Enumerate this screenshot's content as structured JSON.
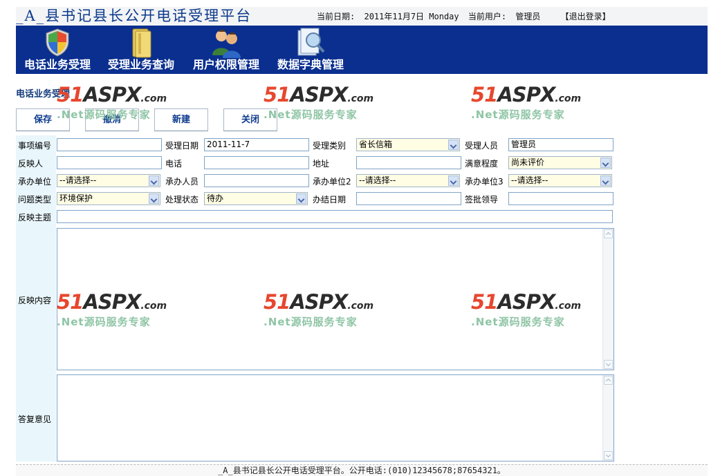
{
  "header": {
    "title": "_A_县书记县长公开电话受理平台",
    "date_label": "当前日期:",
    "date_value": "2011年11月7日 Monday",
    "user_label": "当前用户:",
    "user_value": "管理员",
    "logout": "【退出登录】"
  },
  "nav": {
    "items": [
      {
        "label": "电话业务受理",
        "icon": "shield-icon"
      },
      {
        "label": "受理业务查询",
        "icon": "folder-icon"
      },
      {
        "label": "用户权限管理",
        "icon": "users-icon"
      },
      {
        "label": "数据字典管理",
        "icon": "search-document-icon"
      }
    ]
  },
  "section": {
    "title": "电话业务受理",
    "buttons": {
      "save": "保存",
      "cancel": "撤消",
      "new": "新建",
      "close": "关闭"
    }
  },
  "form": {
    "row1": {
      "item_no_label": "事项编号",
      "item_no_value": "",
      "accept_date_label": "受理日期",
      "accept_date_value": "2011-11-7",
      "accept_type_label": "受理类别",
      "accept_type_value": "省长信箱",
      "acceptor_label": "受理人员",
      "acceptor_value": "管理员"
    },
    "row2": {
      "reporter_label": "反映人",
      "reporter_value": "",
      "phone_label": "电话",
      "phone_value": "",
      "address_label": "地址",
      "address_value": "",
      "satisfaction_label": "满意程度",
      "satisfaction_value": "尚未评价"
    },
    "row3": {
      "unit_label": "承办单位",
      "unit_value": "--请选择--",
      "handler_label": "承办人员",
      "handler_value": "",
      "unit2_label": "承办单位2",
      "unit2_value": "--请选择--",
      "unit3_label": "承办单位3",
      "unit3_value": "--请选择--"
    },
    "row4": {
      "issue_type_label": "问题类型",
      "issue_type_value": "环境保护",
      "status_label": "处理状态",
      "status_value": "待办",
      "finish_date_label": "办结日期",
      "finish_date_value": "",
      "approver_label": "签批领导",
      "approver_value": ""
    },
    "subject_label": "反映主题",
    "content_label": "反映内容",
    "reply_label": "答复意见"
  },
  "watermark": {
    "logo_num": "51",
    "logo_word": "ASPX",
    "logo_domain": ".com",
    "tagline": ".Net源码服务专家"
  },
  "footer": {
    "text": "_A_县书记县长公开电话受理平台。公开电话:(010)12345678;87654321。"
  },
  "colors": {
    "nav_bg": "#0a2f8f",
    "title": "#0d3b8c",
    "form_label_bg": "#e9f6fb",
    "select_bg": "#fffde4"
  }
}
